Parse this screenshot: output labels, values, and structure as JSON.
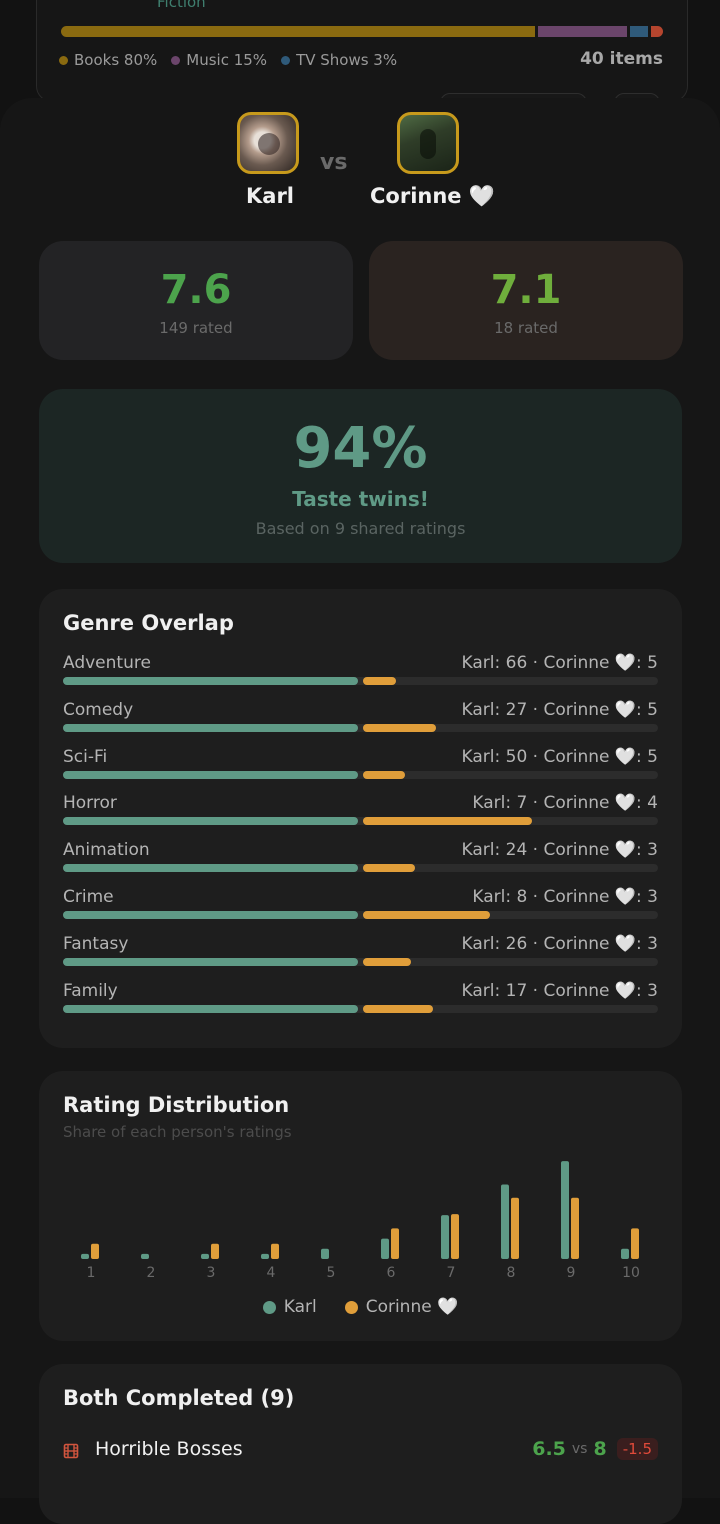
{
  "header_card": {
    "cut_text": "Fiction",
    "type_bar": [
      {
        "label": "Books 80%",
        "percent": 80,
        "color": "#8a6a10"
      },
      {
        "label": "Music 15%",
        "percent": 15,
        "color": "#6b456b"
      },
      {
        "label": "TV Shows 3%",
        "percent": 3,
        "color": "#2f5a7a"
      },
      {
        "label": "",
        "percent": 2,
        "color": "#b5452e"
      }
    ],
    "legend": [
      {
        "label": "Books 80%",
        "color": "#8a6a10"
      },
      {
        "label": "Music 15%",
        "color": "#6b456b"
      },
      {
        "label": "TV Shows 3%",
        "color": "#2f5a7a"
      }
    ],
    "items_count": "40 items"
  },
  "comparison": {
    "vs_label": "vs",
    "user_a": {
      "name": "Karl",
      "score": "7.6",
      "rated": "149 rated"
    },
    "user_b": {
      "name": "Corinne 🤍",
      "score": "7.1",
      "rated": "18 rated"
    }
  },
  "match": {
    "percent": "94%",
    "label": "Taste twins!",
    "sub": "Based on 9 shared ratings"
  },
  "genre_overlap": {
    "title": "Genre Overlap",
    "rows": [
      {
        "genre": "Adventure",
        "counts": "Karl: 66 · Corinne 🤍: 5",
        "karl": 66,
        "corinne": 5
      },
      {
        "genre": "Comedy",
        "counts": "Karl: 27 · Corinne 🤍: 5",
        "karl": 27,
        "corinne": 5
      },
      {
        "genre": "Sci-Fi",
        "counts": "Karl: 50 · Corinne 🤍: 5",
        "karl": 50,
        "corinne": 5
      },
      {
        "genre": "Horror",
        "counts": "Karl: 7 · Corinne 🤍: 4",
        "karl": 7,
        "corinne": 4
      },
      {
        "genre": "Animation",
        "counts": "Karl: 24 · Corinne 🤍: 3",
        "karl": 24,
        "corinne": 3
      },
      {
        "genre": "Crime",
        "counts": "Karl: 8 · Corinne 🤍: 3",
        "karl": 8,
        "corinne": 3
      },
      {
        "genre": "Fantasy",
        "counts": "Karl: 26 · Corinne 🤍: 3",
        "karl": 26,
        "corinne": 3
      },
      {
        "genre": "Family",
        "counts": "Karl: 17 · Corinne 🤍: 3",
        "karl": 17,
        "corinne": 3
      }
    ]
  },
  "chart_data": {
    "type": "bar",
    "title": "Rating Distribution",
    "subtitle": "Share of each person's ratings",
    "categories": [
      "1",
      "2",
      "3",
      "4",
      "5",
      "6",
      "7",
      "8",
      "9",
      "10"
    ],
    "series": [
      {
        "name": "Karl",
        "color": "#5f9a86",
        "values": [
          0.5,
          0.5,
          0.5,
          0.5,
          1.0,
          2.0,
          4.3,
          7.3,
          9.6,
          1.0
        ]
      },
      {
        "name": "Corinne 🤍",
        "color": "#e09e3a",
        "values": [
          1.5,
          0,
          1.5,
          1.5,
          0,
          3.0,
          4.4,
          6.0,
          6.0,
          3.0
        ]
      }
    ],
    "ylim": [
      0,
      10
    ],
    "legend": "bottom-center"
  },
  "both_completed": {
    "title": "Both Completed (9)",
    "items": [
      {
        "title": "Horrible Bosses",
        "score_a": "6.5",
        "vs": "vs",
        "score_b": "8",
        "diff": "-1.5"
      }
    ]
  }
}
